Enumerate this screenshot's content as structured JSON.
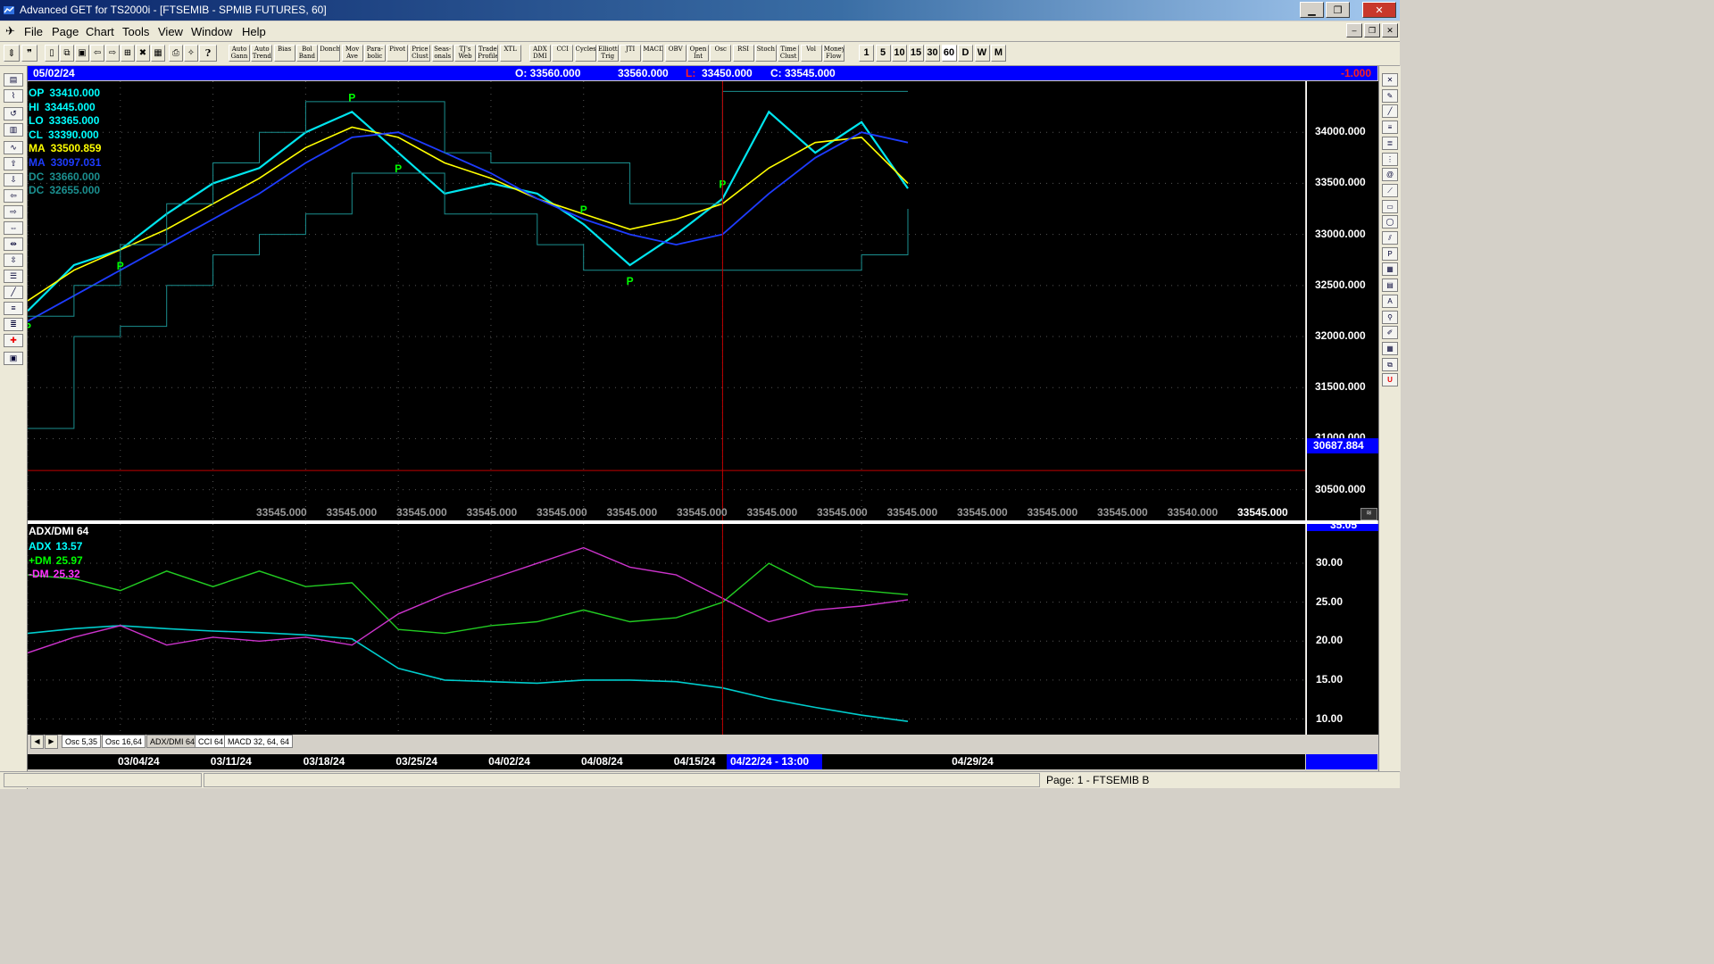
{
  "window": {
    "title": "Advanced GET for TS2000i - [FTSEMIB - SPMIB FUTURES, 60]",
    "minimize": "▁",
    "restore": "❐",
    "close": "✕"
  },
  "menu": [
    "File",
    "Page",
    "Chart",
    "Tools",
    "View",
    "Window",
    "Help"
  ],
  "toolbar": {
    "indicators": [
      "Auto Gann",
      "Auto Trend",
      "Bias",
      "Bol Band",
      "Donch",
      "Mov Ave",
      "Para- bolic",
      "Pivot",
      "Price Clust",
      "Seas- onals",
      "TJ's Web",
      "Trade Profile",
      "XTL",
      "ADX DMI",
      "CCI",
      "Cycles",
      "Elliott Trig",
      "JTI",
      "MACD",
      "OBV",
      "Open Int",
      "Osc",
      "RSI",
      "Stoch",
      "Time Clust",
      "Vol",
      "Money Flow"
    ],
    "intervals": [
      "1",
      "5",
      "10",
      "15",
      "30",
      "60",
      "D",
      "W",
      "M"
    ]
  },
  "header": {
    "date": "05/02/24",
    "open": "O: 33560.000",
    "high": "33560.000",
    "low_label": "L:",
    "low": "33450.000",
    "close": "C: 33545.000",
    "change": "-1.000"
  },
  "price_readouts": [
    {
      "label": "OP",
      "value": "33410.000",
      "color": "#00ffff"
    },
    {
      "label": "HI",
      "value": "33445.000",
      "color": "#00ffff"
    },
    {
      "label": "LO",
      "value": "33365.000",
      "color": "#00ffff"
    },
    {
      "label": "CL",
      "value": "33390.000",
      "color": "#00ffff"
    },
    {
      "label": "MA",
      "value": "33500.859",
      "color": "#ffff00"
    },
    {
      "label": "MA",
      "value": "33097.031",
      "color": "#1e3cff"
    },
    {
      "label": "DC",
      "value": "33660.000",
      "color": "#1b8f8f"
    },
    {
      "label": "DC",
      "value": "32655.000",
      "color": "#1b8f8f"
    }
  ],
  "price_axis": {
    "ticks": [
      "34000.000",
      "33500.000",
      "33000.000",
      "32500.000",
      "32000.000",
      "31500.000",
      "31000.000",
      "30500.000"
    ],
    "cursor_value": "30687.884"
  },
  "bottom_values": [
    "33545.000",
    "33545.000",
    "33545.000",
    "33545.000",
    "33545.000",
    "33545.000",
    "33545.000",
    "33545.000",
    "33545.000",
    "33545.000",
    "33545.000",
    "33545.000",
    "33545.000",
    "33540.000",
    "33545.000"
  ],
  "adx_panel": {
    "title": "ADX/DMI 64",
    "readouts": [
      {
        "label": "ADX",
        "value": "13.57",
        "color": "#00ffff"
      },
      {
        "label": "+DM",
        "value": "25.97",
        "color": "#00ff00"
      },
      {
        "label": "-DM",
        "value": "25.32",
        "color": "#ff33ff"
      }
    ],
    "ticks": [
      "30.00",
      "25.00",
      "20.00",
      "15.00",
      "10.00"
    ],
    "top_value": "35.05"
  },
  "tabs": [
    "Osc 5,35",
    "Osc 16,64",
    "ADX/DMI 64",
    "CCI 64",
    "MACD 32, 64, 64"
  ],
  "date_axis": {
    "labels": [
      "03/04/24",
      "03/11/24",
      "03/18/24",
      "03/25/24",
      "04/02/24",
      "04/08/24",
      "04/15/24",
      "04/29/24"
    ],
    "cursor_date": "04/22/24 - 13:00"
  },
  "status": {
    "page": "Page: 1 - FTSEMIB B"
  },
  "pivot_marker": "P",
  "colors": {
    "price": "#00e5ee",
    "ma_fast": "#ffff00",
    "ma_slow": "#1e3cff",
    "donchian": "#1b8f8f",
    "adx": "#00cccc",
    "plus_dm": "#22cc22",
    "minus_dm": "#cc33cc",
    "pivot": "#00ff00",
    "cursor": "#c00000"
  },
  "chart_data": [
    {
      "type": "line",
      "instrument": "FTSEMIB - SPMIB FUTURES, 60",
      "x": [
        "03/04/24",
        "03/07/24",
        "03/11/24",
        "03/14/24",
        "03/18/24",
        "03/21/24",
        "03/25/24",
        "03/27/24",
        "04/02/24",
        "04/04/24",
        "04/08/24",
        "04/11/24",
        "04/15/24",
        "04/17/24",
        "04/19/24",
        "04/22/24",
        "04/24/24",
        "04/26/24",
        "04/29/24",
        "05/02/24"
      ],
      "series": [
        {
          "name": "CL",
          "values": [
            32250,
            32700,
            32850,
            33200,
            33500,
            33650,
            34000,
            34200,
            33800,
            33400,
            33500,
            33400,
            33100,
            32700,
            33000,
            33350,
            34200,
            33800,
            34100,
            33450
          ]
        },
        {
          "name": "MA",
          "values": [
            32350,
            32650,
            32850,
            33050,
            33300,
            33550,
            33850,
            34050,
            33950,
            33700,
            33550,
            33350,
            33200,
            33050,
            33150,
            33300,
            33650,
            33900,
            33950,
            33500
          ]
        },
        {
          "name": "MA",
          "values": [
            32150,
            32400,
            32650,
            32900,
            33150,
            33400,
            33700,
            33950,
            34000,
            33800,
            33600,
            33350,
            33150,
            33000,
            32900,
            33000,
            33400,
            33750,
            34000,
            33900
          ]
        },
        {
          "name": "DC",
          "values": [
            32200,
            32500,
            32900,
            33300,
            33700,
            34000,
            34300,
            34300,
            34300,
            33800,
            33700,
            33700,
            33700,
            33300,
            33300,
            34400,
            34400,
            34400,
            34400,
            34400
          ]
        },
        {
          "name": "DC",
          "values": [
            31100,
            32000,
            32100,
            32500,
            32800,
            33000,
            33200,
            33600,
            33600,
            33200,
            33200,
            32900,
            32650,
            32650,
            32650,
            32650,
            32650,
            32650,
            32800,
            33250
          ]
        }
      ],
      "ylim": [
        30200,
        34500
      ],
      "pivots": [
        {
          "x": "03/04/24",
          "type": "low"
        },
        {
          "x": "03/11/24",
          "type": "low"
        },
        {
          "x": "03/27/24",
          "type": "high"
        },
        {
          "x": "04/02/24",
          "type": "low"
        },
        {
          "x": "04/15/24",
          "type": "high"
        },
        {
          "x": "04/17/24",
          "type": "low"
        },
        {
          "x": "04/22/24",
          "type": "high"
        }
      ]
    },
    {
      "type": "line",
      "title": "ADX/DMI 64",
      "x": [
        "03/04/24",
        "03/07/24",
        "03/11/24",
        "03/14/24",
        "03/18/24",
        "03/21/24",
        "03/25/24",
        "03/27/24",
        "04/02/24",
        "04/04/24",
        "04/08/24",
        "04/11/24",
        "04/15/24",
        "04/17/24",
        "04/19/24",
        "04/22/24",
        "04/24/24",
        "04/26/24",
        "04/29/24",
        "05/02/24"
      ],
      "series": [
        {
          "name": "ADX",
          "values": [
            21.0,
            21.6,
            22.0,
            21.6,
            21.3,
            21.1,
            20.8,
            20.3,
            16.5,
            15.0,
            14.8,
            14.6,
            15.0,
            15.0,
            14.8,
            14.0,
            12.6,
            11.5,
            10.5,
            9.7
          ]
        },
        {
          "name": "+DM",
          "values": [
            28.5,
            28.0,
            26.5,
            29.0,
            27.0,
            29.0,
            27.0,
            27.5,
            21.5,
            21.0,
            22.0,
            22.5,
            24.0,
            22.5,
            23.0,
            25.0,
            30.0,
            27.0,
            26.5,
            25.97
          ]
        },
        {
          "name": "-DM",
          "values": [
            18.5,
            20.5,
            22.0,
            19.5,
            20.5,
            20.0,
            20.5,
            19.5,
            23.5,
            26.0,
            28.0,
            30.0,
            32.0,
            29.5,
            28.5,
            25.5,
            22.5,
            24.0,
            24.5,
            25.32
          ]
        }
      ],
      "ylim": [
        8.0,
        35.05
      ]
    }
  ]
}
